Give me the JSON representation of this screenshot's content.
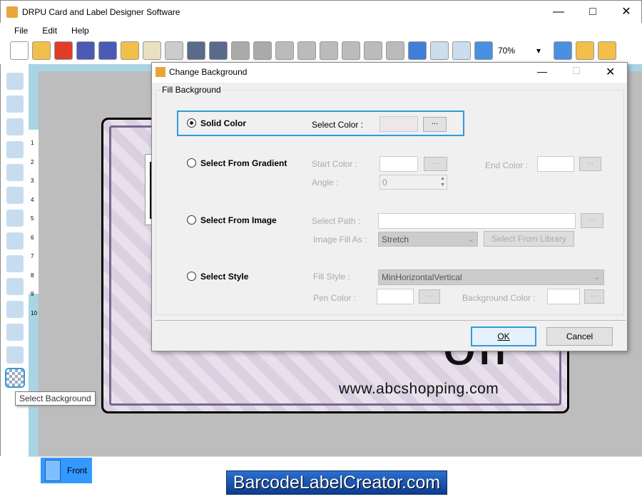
{
  "app": {
    "title": "DRPU Card and Label Designer Software",
    "icon": "app-icon"
  },
  "menu": [
    "File",
    "Edit",
    "Help"
  ],
  "toolbar": {
    "icons": [
      "new-icon",
      "open-icon",
      "close-icon",
      "save-icon",
      "save-as-icon",
      "open-template-icon",
      "edit-icon",
      "print-icon",
      "database-add-icon",
      "database-icon",
      "undo-icon",
      "redo-icon",
      "copy-icon",
      "cut-icon",
      "paste-icon",
      "delete-icon",
      "bring-front-icon",
      "send-back-icon",
      "grid-icon",
      "center-icon",
      "fit-icon",
      "zoom-in-icon",
      "zoom-out-icon",
      "lock-icon",
      "unlock-icon"
    ],
    "zoom": "70%"
  },
  "tools": [
    "select-move-icon",
    "line-icon",
    "ellipse-icon",
    "pencil-icon",
    "rectangle-icon",
    "text-icon",
    "curve-icon",
    "star-icon",
    "triangle-icon",
    "barcode-icon",
    "image-icon",
    "image-library-icon",
    "wordart-icon",
    "background-icon"
  ],
  "ruler": [
    "1",
    "2",
    "3",
    "4",
    "5",
    "6",
    "7",
    "8",
    "9",
    "10"
  ],
  "tooltip": "Select Background",
  "card": {
    "big_text": "off",
    "url": "www.abcshopping.com"
  },
  "tabs": {
    "front": "Front"
  },
  "brand": "BarcodeLabelCreator.com",
  "dialog": {
    "title": "Change Background",
    "group": "Fill Background",
    "solid": {
      "label": "Solid Color",
      "select_color": "Select Color :",
      "color": "#ede7e9",
      "button": "..."
    },
    "gradient": {
      "label": "Select From Gradient",
      "start": "Start Color :",
      "end": "End Color :",
      "angle": "Angle :",
      "angle_value": "0",
      "button": "..."
    },
    "image": {
      "label": "Select From Image",
      "path": "Select Path :",
      "fill_as": "Image Fill As :",
      "fill_value": "Stretch",
      "library": "Select From Library",
      "button": "..."
    },
    "style": {
      "label": "Select Style",
      "fill_style": "Fill Style :",
      "fill_value": "MinHorizontalVertical",
      "pen": "Pen Color :",
      "bg": "Background Color :",
      "button": "..."
    },
    "ok": "OK",
    "cancel": "Cancel"
  },
  "colors": {
    "accent": "#3399ff",
    "ruler": "#a9d4e4",
    "canvas": "#bdbdbd"
  }
}
